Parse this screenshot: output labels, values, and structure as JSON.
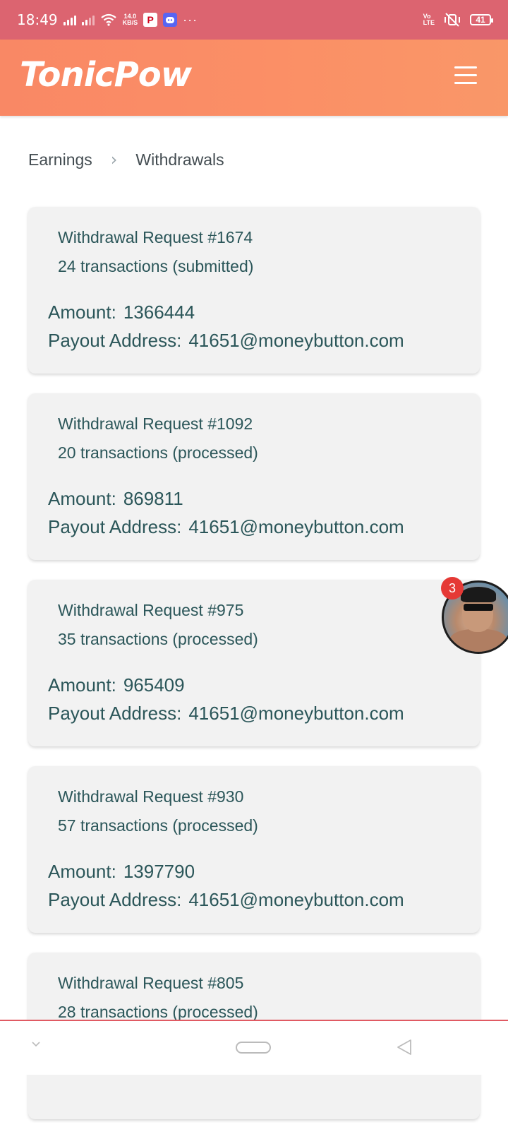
{
  "status_bar": {
    "time": "18:49",
    "net_speed_value": "14.0",
    "net_speed_unit": "KB/S",
    "pinterest_glyph": "P",
    "more": "···",
    "volte_top": "Vo",
    "volte_bottom": "LTE",
    "battery": "41"
  },
  "header": {
    "logo": "TonicPow",
    "menu_icon": "hamburger-menu-icon"
  },
  "breadcrumb": {
    "items": [
      "Earnings",
      "Withdrawals"
    ],
    "separator": "›"
  },
  "withdrawals": [
    {
      "title": "Withdrawal Request #1674",
      "transactions": "24 transactions (submitted)",
      "amount_label": "Amount:",
      "amount": "1366444",
      "payout_label": "Payout Address:",
      "payout": "41651@moneybutton.com"
    },
    {
      "title": "Withdrawal Request #1092",
      "transactions": "20 transactions (processed)",
      "amount_label": "Amount:",
      "amount": "869811",
      "payout_label": "Payout Address:",
      "payout": "41651@moneybutton.com"
    },
    {
      "title": "Withdrawal Request #975",
      "transactions": "35 transactions (processed)",
      "amount_label": "Amount:",
      "amount": "965409",
      "payout_label": "Payout Address:",
      "payout": "41651@moneybutton.com"
    },
    {
      "title": "Withdrawal Request #930",
      "transactions": "57 transactions (processed)",
      "amount_label": "Amount:",
      "amount": "1397790",
      "payout_label": "Payout Address:",
      "payout": "41651@moneybutton.com"
    },
    {
      "title": "Withdrawal Request #805",
      "transactions": "28 transactions (processed)",
      "amount_label": "",
      "amount": "",
      "payout_label": "",
      "payout": ""
    }
  ],
  "chat_head": {
    "badge_count": "3"
  },
  "nav_bar": {
    "icons": [
      "chevron-down-icon",
      "home-pill-icon",
      "back-triangle-icon"
    ]
  },
  "colors": {
    "status_bar": "#dc6470",
    "header": "#fb8f66",
    "card_bg": "#f2f2f2",
    "card_text": "#2b5659",
    "badge": "#e53935"
  }
}
